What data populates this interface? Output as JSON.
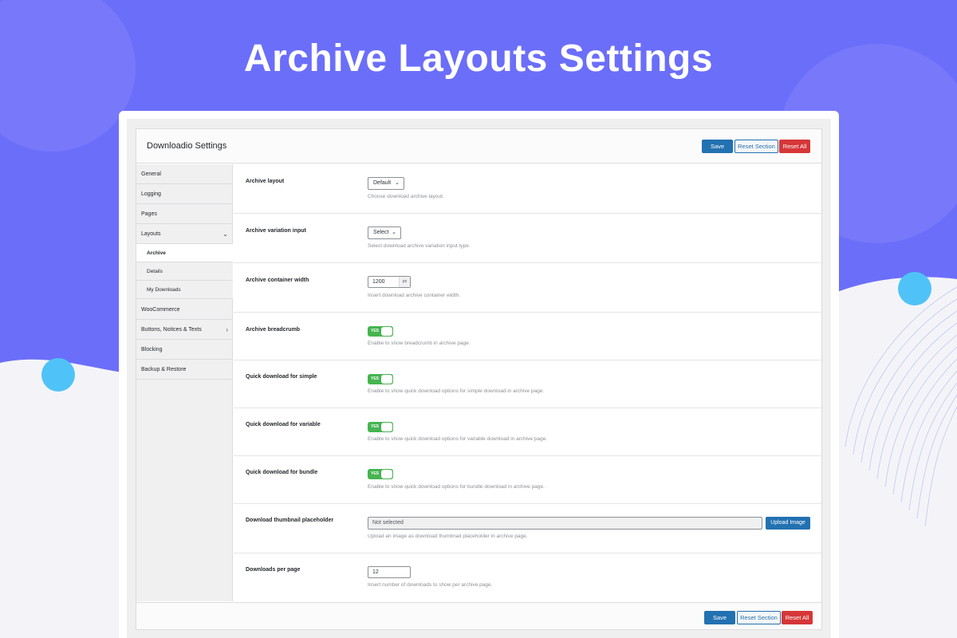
{
  "hero": {
    "title": "Archive Layouts Settings"
  },
  "colors": {
    "accent": "#6b6ef9",
    "primary": "#2271b1",
    "danger": "#d63638",
    "toggle_on": "#46b450"
  },
  "header": {
    "title": "Downloadio Settings"
  },
  "actions": {
    "save": "Save",
    "reset_section": "Reset Section",
    "reset_all": "Reset All"
  },
  "sidebar": {
    "items": [
      {
        "label": "General"
      },
      {
        "label": "Logging"
      },
      {
        "label": "Pages"
      },
      {
        "label": "Layouts",
        "icon": "chevron-down-icon"
      },
      {
        "label": "WooCommerce"
      },
      {
        "label": "Buttons, Notices & Texts",
        "icon": "chevron-right-icon"
      },
      {
        "label": "Blocking"
      },
      {
        "label": "Backup & Restore"
      }
    ],
    "subitems": [
      {
        "label": "Archive",
        "active": true
      },
      {
        "label": "Details"
      },
      {
        "label": "My Downloads"
      }
    ]
  },
  "fields": {
    "archive_layout": {
      "label": "Archive layout",
      "value": "Default",
      "desc": "Choose download archive layout."
    },
    "variation_input": {
      "label": "Archive variation input",
      "value": "Select",
      "desc": "Select download archive variation input type."
    },
    "container_width": {
      "label": "Archive container width",
      "value": "1200",
      "unit": "px",
      "desc": "Insert download archive container width."
    },
    "breadcrumb": {
      "label": "Archive breadcrumb",
      "toggle": "YES",
      "desc": "Enable to show breadcrumb in archive page."
    },
    "quick_simple": {
      "label": "Quick download for simple",
      "toggle": "YES",
      "desc": "Enable to show quick download options for simple download in archive page."
    },
    "quick_variable": {
      "label": "Quick download for variable",
      "toggle": "YES",
      "desc": "Enable to show quick download options for variable download in archive page."
    },
    "quick_bundle": {
      "label": "Quick download for bundle",
      "toggle": "YES",
      "desc": "Enable to show quick download options for bundle download in archive page."
    },
    "thumbnail": {
      "label": "Download thumbnail placeholder",
      "value": "Not selected",
      "button": "Upload Image",
      "desc": "Upload an image as download thumbnail placeholder in archive page."
    },
    "per_page": {
      "label": "Downloads per page",
      "value": "12",
      "desc": "Insert number of downloads to show per archive page."
    }
  }
}
